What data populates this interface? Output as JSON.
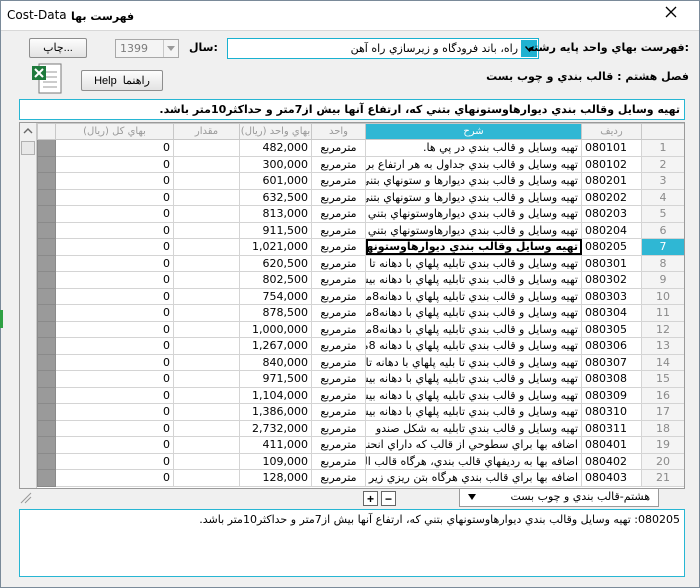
{
  "window": {
    "title_left": "Cost-Data",
    "title_right": "فهرست بها"
  },
  "toolbar": {
    "print_label": "چاپ...",
    "year_label": "سال:",
    "year_value": "1399",
    "field_label": "فهرست بهاي واحد پايه رشته:",
    "field_value": "راه، باند فرودگاه و زيرسازي راه آهن",
    "help_label": "Help",
    "help_label_fa": "راهنما",
    "chapter_label": "فصل هشتم : قالب بندي و چوب بست"
  },
  "description_bar": "تهيه وسايل وقالب بندي ديوارهاوستونهاي بتني كه،  ارتفاع آنها بيش از7متر و حداكثر10متر باشد.",
  "table": {
    "headers": {
      "idx": "",
      "code": "رديف",
      "desc": "شرح",
      "unit": "واحد",
      "unit_price": "بهاي واحد (ريال)",
      "qty": "مقدار",
      "total": "بهاي كل (ريال)"
    },
    "rows": [
      {
        "idx": "1",
        "code": "080101",
        "desc": "تهيه وسايل و قالب بندي  در پي ها.",
        "unit": "مترمربع",
        "price": "482,000",
        "qty": "",
        "total": "0"
      },
      {
        "idx": "2",
        "code": "080102",
        "desc": "تهيه وسايل و قالب بندي جداول به هر  ارتفاع براي",
        "unit": "مترمربع",
        "price": "300,000",
        "qty": "",
        "total": "0"
      },
      {
        "idx": "3",
        "code": "080201",
        "desc": "تهيه وسايل و قالب بندي ديوارها و ستونهاي بتني ك",
        "unit": "مترمربع",
        "price": "601,000",
        "qty": "",
        "total": "0"
      },
      {
        "idx": "4",
        "code": "080202",
        "desc": "تهيه وسايل و قالب بندي ديوارها و ستونهاي بتني ك",
        "unit": "مترمربع",
        "price": "632,500",
        "qty": "",
        "total": "0"
      },
      {
        "idx": "5",
        "code": "080203",
        "desc": "تهيه وسايل و قالب بندي ديوارهاوستونهاي بتني كه،",
        "unit": "مترمربع",
        "price": "813,000",
        "qty": "",
        "total": "0"
      },
      {
        "idx": "6",
        "code": "080204",
        "desc": "تهيه وسايل و قالب بندي ديوارهاوستونهاي بتني كه،",
        "unit": "مترمربع",
        "price": "911,500",
        "qty": "",
        "total": "0"
      },
      {
        "idx": "7",
        "code": "080205",
        "desc": "تهيه وسايل وقالب بندي ديوارهاوستونهاي بتني كه،",
        "unit": "مترمربع",
        "price": "1,021,000",
        "qty": "",
        "total": "0"
      },
      {
        "idx": "8",
        "code": "080301",
        "desc": "تهيه وسايل و قالب بندي تابليه پلهاي با دهانه تا 5",
        "unit": "مترمربع",
        "price": "620,500",
        "qty": "",
        "total": "0"
      },
      {
        "idx": "9",
        "code": "080302",
        "desc": "تهيه وسايل و قالب بندي تابليه پلهاي با دهانه بيش ا",
        "unit": "مترمربع",
        "price": "802,500",
        "qty": "",
        "total": "0"
      },
      {
        "idx": "10",
        "code": "080303",
        "desc": "تهيه وسايل و قالب بندي تابليه پلهاي با دهانه8متر",
        "unit": "مترمربع",
        "price": "754,000",
        "qty": "",
        "total": "0"
      },
      {
        "idx": "11",
        "code": "080304",
        "desc": "تهيه وسايل و قالب بندي تابليه پلهاي با دهانه8متر",
        "unit": "مترمربع",
        "price": "878,500",
        "qty": "",
        "total": "0"
      },
      {
        "idx": "12",
        "code": "080305",
        "desc": "تهيه وسايل و قالب بندي تابليه پلهاي با دهانه8متر",
        "unit": "مترمربع",
        "price": "1,000,000",
        "qty": "",
        "total": "0"
      },
      {
        "idx": "13",
        "code": "080306",
        "desc": "تهيه وسايل و قالب بندي تابليه پلهاي با دهانه 8متر",
        "unit": "مترمربع",
        "price": "1,267,000",
        "qty": "",
        "total": "0"
      },
      {
        "idx": "14",
        "code": "080307",
        "desc": "تهيه وسايل و قالب بندي تا بليه پلهاي با دهانه تا 5",
        "unit": "مترمربع",
        "price": "840,000",
        "qty": "",
        "total": "0"
      },
      {
        "idx": "15",
        "code": "080308",
        "desc": "تهيه وسايل و قالب بندي تابليه پلهاي با دهانه بيش ا",
        "unit": "مترمربع",
        "price": "971,500",
        "qty": "",
        "total": "0"
      },
      {
        "idx": "16",
        "code": "080309",
        "desc": "تهيه وسايل و قالب بندي تابليه پلهاي با دهانه بيش ا",
        "unit": "مترمربع",
        "price": "1,104,000",
        "qty": "",
        "total": "0"
      },
      {
        "idx": "17",
        "code": "080310",
        "desc": "تهيه وسايل و قالب بندي تابليه پلهاي با دهانه بيش ا",
        "unit": "مترمربع",
        "price": "1,386,000",
        "qty": "",
        "total": "0"
      },
      {
        "idx": "18",
        "code": "080311",
        "desc": "تهيه وسايل و قالب بندي تابليه به شكل صندو",
        "unit": "مترمربع",
        "price": "2,732,000",
        "qty": "",
        "total": "0"
      },
      {
        "idx": "19",
        "code": "080401",
        "desc": "اضافه بها براي سطوحي از قالب كه داراي انحنا ب",
        "unit": "مترمربع",
        "price": "411,000",
        "qty": "",
        "total": "0"
      },
      {
        "idx": "20",
        "code": "080402",
        "desc": "اضافه بها به رديفهاي قالب بندي، هرگاه قالب الزاما",
        "unit": "مترمربع",
        "price": "109,000",
        "qty": "",
        "total": "0"
      },
      {
        "idx": "21",
        "code": "080403",
        "desc": "اضافه بها براي قالب بندي هرگاه بتن ريزي زير",
        "unit": "مترمربع",
        "price": "128,000",
        "qty": "",
        "total": "0"
      }
    ]
  },
  "tabs": {
    "plus": "+",
    "minus": "−",
    "active_tab": "هشتم-قالب بندي و چوب بست"
  },
  "detail_text": "080205: تهيه وسايل وقالب بندي ديوارهاوستونهاي بتني كه،  ارتفاع آنها بيش از7متر و حداكثر10متر باشد.",
  "colors": {
    "accent": "#2fb7d4",
    "header_gray": "#9a9a9a"
  }
}
